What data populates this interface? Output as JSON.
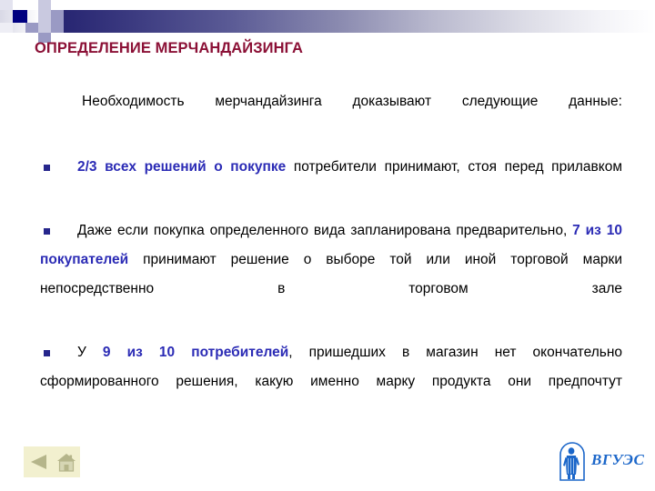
{
  "slide": {
    "title": "ОПРЕДЕЛЕНИЕ МЕРЧАНДАЙЗИНГА",
    "title_color": "#8B1036",
    "accent_color": "#2B2BB5",
    "band_color_start": "#1B1B6E",
    "band_color_end": "#FFFFFF",
    "bullet_color": "#26268C"
  },
  "body": {
    "lead_paragraph": "Необходимость мерчандайзинга доказывают следующие данные:",
    "bullets": [
      {
        "marker": "square-bullet",
        "segments": [
          {
            "text": "2/3 всех решений о покупке",
            "highlight": true
          },
          {
            "text": " потребители принимают, стоя перед прилавком",
            "highlight": false
          }
        ]
      },
      {
        "marker": "square-bullet",
        "segments": [
          {
            "text": "Даже если покупка определенного вида запланирована предварительно, ",
            "highlight": false
          },
          {
            "text": "7 из 10 покупателей",
            "highlight": true
          },
          {
            "text": " принимают решение о выборе той или иной торговой марки непосредственно в торговом зале",
            "highlight": false
          }
        ]
      },
      {
        "marker": "square-bullet",
        "segments": [
          {
            "text": "У ",
            "highlight": false
          },
          {
            "text": "9 из 10 потребителей",
            "highlight": true
          },
          {
            "text": ", пришедших в магазин нет окончательно сформированного решения, какую именно марку продукта они предпочтут",
            "highlight": false
          }
        ]
      }
    ]
  },
  "footer": {
    "nav": {
      "back_label": "Назад",
      "home_label": "На главную",
      "background_color": "#F2F0CF"
    },
    "logo": {
      "wordmark": "ВГУЭС",
      "color": "#1B66C9"
    }
  }
}
